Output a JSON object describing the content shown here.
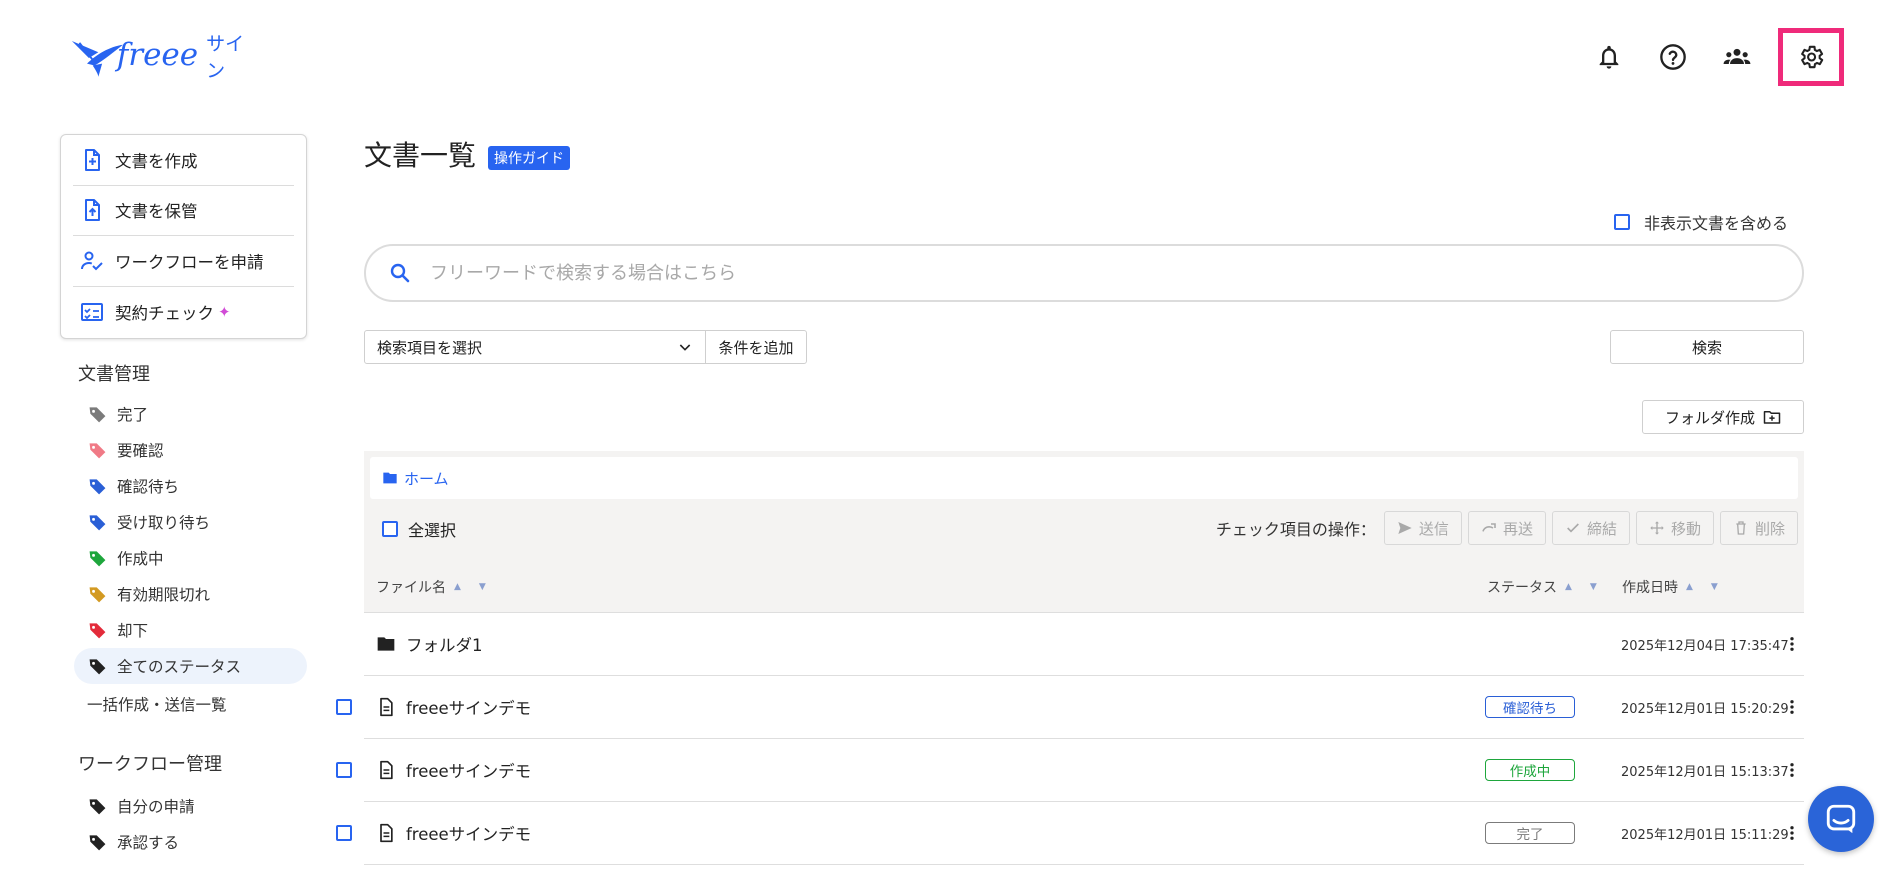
{
  "header": {
    "logo_text": "freee",
    "logo_sub": "サイン",
    "icons": [
      "bell-icon",
      "help-icon",
      "team-icon",
      "gear-icon"
    ]
  },
  "sidebar": {
    "actions": [
      {
        "label": "文書を作成",
        "icon": "document-plus-icon"
      },
      {
        "label": "文書を保管",
        "icon": "document-upload-icon"
      },
      {
        "label": "ワークフローを申請",
        "icon": "user-check-icon"
      },
      {
        "label": "契約チェック",
        "icon": "checklist-icon",
        "extra": "✦"
      }
    ],
    "doc_section": "文書管理",
    "tags": [
      {
        "label": "完了",
        "color": "#7b7b7b"
      },
      {
        "label": "要確認",
        "color": "#f07a86"
      },
      {
        "label": "確認待ち",
        "color": "#2a5fd6"
      },
      {
        "label": "受け取り待ち",
        "color": "#2a5fd6"
      },
      {
        "label": "作成中",
        "color": "#1ea63c"
      },
      {
        "label": "有効期限切れ",
        "color": "#d39a22"
      },
      {
        "label": "却下",
        "color": "#e32b3a"
      },
      {
        "label": "全てのステータス",
        "color": "#222222"
      }
    ],
    "bulk_link": "一括作成・送信一覧",
    "workflow_section": "ワークフロー管理",
    "workflow_tags": [
      {
        "label": "自分の申請",
        "color": "#222222"
      },
      {
        "label": "承認する",
        "color": "#222222"
      }
    ]
  },
  "main": {
    "title": "文書一覧",
    "guide_badge": "操作ガイド",
    "hidden_docs_label": "非表示文書を含める",
    "search_placeholder": "フリーワードで検索する場合はこちら",
    "field_select": "検索項目を選択",
    "add_condition": "条件を追加",
    "search_button": "検索",
    "folder_button": "フォルダ作成",
    "breadcrumb_home": "ホーム",
    "select_all": "全選択",
    "bulk_label": "チェック項目の操作：",
    "bulk_actions": [
      {
        "label": "送信",
        "icon": "send-icon"
      },
      {
        "label": "再送",
        "icon": "redo-icon"
      },
      {
        "label": "締結",
        "icon": "check-icon"
      },
      {
        "label": "移動",
        "icon": "move-icon"
      },
      {
        "label": "削除",
        "icon": "trash-icon"
      }
    ],
    "columns": {
      "name": "ファイル名",
      "status": "ステータス",
      "created": "作成日時"
    },
    "rows": [
      {
        "type": "folder",
        "name": "フォルダ1",
        "status": "",
        "status_color": "",
        "date": "2025年12月04日 17:35:47"
      },
      {
        "type": "document",
        "name": "freeeサインデモ",
        "status": "確認待ち",
        "status_color": "#2a5fd6",
        "date": "2025年12月01日 15:20:29"
      },
      {
        "type": "document",
        "name": "freeeサインデモ",
        "status": "作成中",
        "status_color": "#1ea63c",
        "date": "2025年12月01日 15:13:37"
      },
      {
        "type": "document",
        "name": "freeeサインデモ",
        "status": "完了",
        "status_color": "#7b7b7b",
        "date": "2025年12月01日 15:11:29"
      }
    ]
  },
  "colors": {
    "accent": "#2864f0",
    "highlight": "#ef2a7a"
  }
}
